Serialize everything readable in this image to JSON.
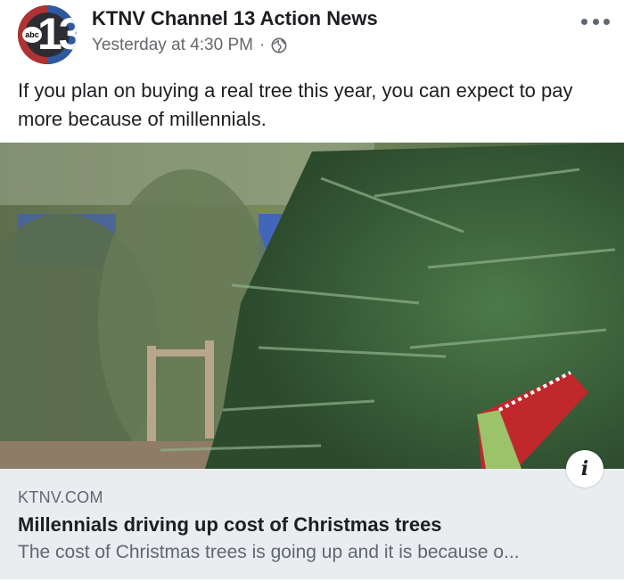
{
  "post": {
    "page_name": "KTNV Channel 13 Action News",
    "timestamp": "Yesterday at 4:30 PM",
    "separator": "·",
    "privacy_icon": "globe-icon",
    "more_icon": "more-options-icon",
    "caption": "If you plan on buying a real tree this year, you can expect to pay more because of millennials."
  },
  "avatar": {
    "number": "13",
    "network": "abc",
    "colors": {
      "ring_left": "#d62f2f",
      "ring_right": "#2f5fb3",
      "fill": "#2b2d33"
    }
  },
  "link_preview": {
    "domain": "KTNV.COM",
    "title": "Millennials driving up cost of Christmas trees",
    "description": "The cost of Christmas trees is going up and it is because o...",
    "info_icon": "info-icon",
    "info_symbol": "i"
  }
}
